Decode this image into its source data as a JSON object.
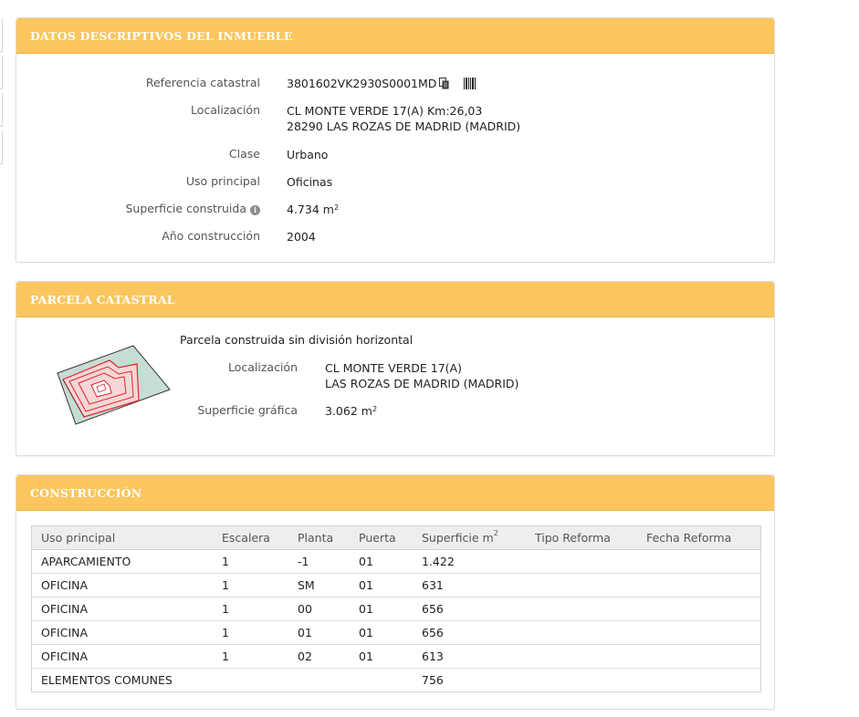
{
  "datos": {
    "title": "DATOS DESCRIPTIVOS DEL INMUEBLE",
    "ref_label": "Referencia catastral",
    "ref_value": "3801602VK2930S0001MD",
    "loc_label": "Localización",
    "loc_line1": "CL MONTE VERDE 17(A) Km:26,03",
    "loc_line2": "28290 LAS ROZAS DE MADRID (MADRID)",
    "clase_label": "Clase",
    "clase_value": "Urbano",
    "uso_label": "Uso principal",
    "uso_value": "Oficinas",
    "sup_label": "Superficie construida",
    "sup_value": "4.734 m",
    "sup_unit_exp": "2",
    "anio_label": "Año construcción",
    "anio_value": "2004"
  },
  "parcela": {
    "title": "PARCELA CATASTRAL",
    "subtitle": "Parcela construida sin división horizontal",
    "loc_label": "Localización",
    "loc_line1": "CL MONTE VERDE 17(A)",
    "loc_line2": "LAS ROZAS DE MADRID (MADRID)",
    "sup_label": "Superficie gráfica",
    "sup_value": "3.062 m",
    "sup_unit_exp": "2"
  },
  "construccion": {
    "title": "CONSTRUCCIÓN",
    "columns": [
      "Uso principal",
      "Escalera",
      "Planta",
      "Puerta",
      "Superficie m",
      "Tipo Reforma",
      "Fecha Reforma"
    ],
    "sup_col_exp": "2",
    "rows": [
      [
        "APARCAMIENTO",
        "1",
        "-1",
        "01",
        "1.422",
        "",
        ""
      ],
      [
        "OFICINA",
        "1",
        "SM",
        "01",
        "631",
        "",
        ""
      ],
      [
        "OFICINA",
        "1",
        "00",
        "01",
        "656",
        "",
        ""
      ],
      [
        "OFICINA",
        "1",
        "01",
        "01",
        "656",
        "",
        ""
      ],
      [
        "OFICINA",
        "1",
        "02",
        "01",
        "613",
        "",
        ""
      ],
      [
        "ELEMENTOS COMUNES",
        "",
        "",
        "",
        "756",
        "",
        ""
      ]
    ]
  },
  "icons": {
    "copy": "copy-icon",
    "barcode": "barcode-icon",
    "info": "info-icon"
  },
  "colors": {
    "header_bg": "#fbc65e",
    "header_text": "#ffffff",
    "parcel_fill": "#c6ddd3",
    "building_outline": "#e0242d"
  }
}
